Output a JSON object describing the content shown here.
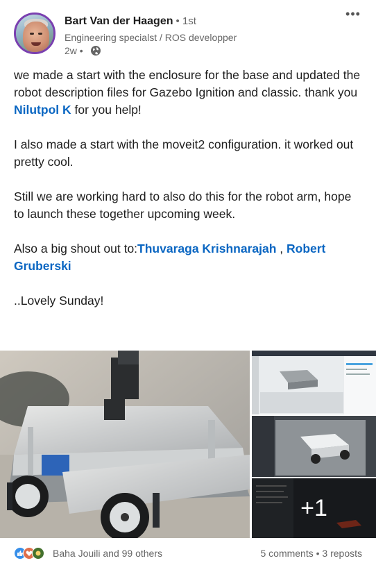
{
  "author": {
    "name": "Bart Van der Haagen",
    "degree": "• 1st",
    "headline": "Engineering specialst / ROS developper",
    "time": "2w •"
  },
  "post": {
    "p1_a": "we made a start with the enclosure for the base and updated the robot description files for Gazebo Ignition and classic. thank you ",
    "p1_mention": "Nilutpol K",
    "p1_b": " for you help!",
    "p2": "I also made a start with the moveit2 configuration. it worked out pretty cool.",
    "p3": "Still we are working hard to also do this for the robot arm, hope to launch these together upcoming week.",
    "p4_a": "Also a big shout out to:",
    "p4_mention1": "Thuvaraga Krishnarajah",
    "p4_sep": " , ",
    "p4_mention2": "Robert Gruberski",
    "p5": " ..Lovely Sunday!"
  },
  "media": {
    "more_count": "+1"
  },
  "social": {
    "reactions_text": "Baha Jouili and 99 others",
    "stats_text": "5 comments • 3 reposts"
  },
  "icons": {
    "menu": "more-horizontal-icon",
    "visibility": "globe-icon",
    "reactions": [
      "like-icon",
      "love-icon",
      "support-icon"
    ]
  },
  "colors": {
    "accent": "#0a66c2",
    "avatar_ring": "#7a3fb0",
    "muted_text": "#666666"
  }
}
